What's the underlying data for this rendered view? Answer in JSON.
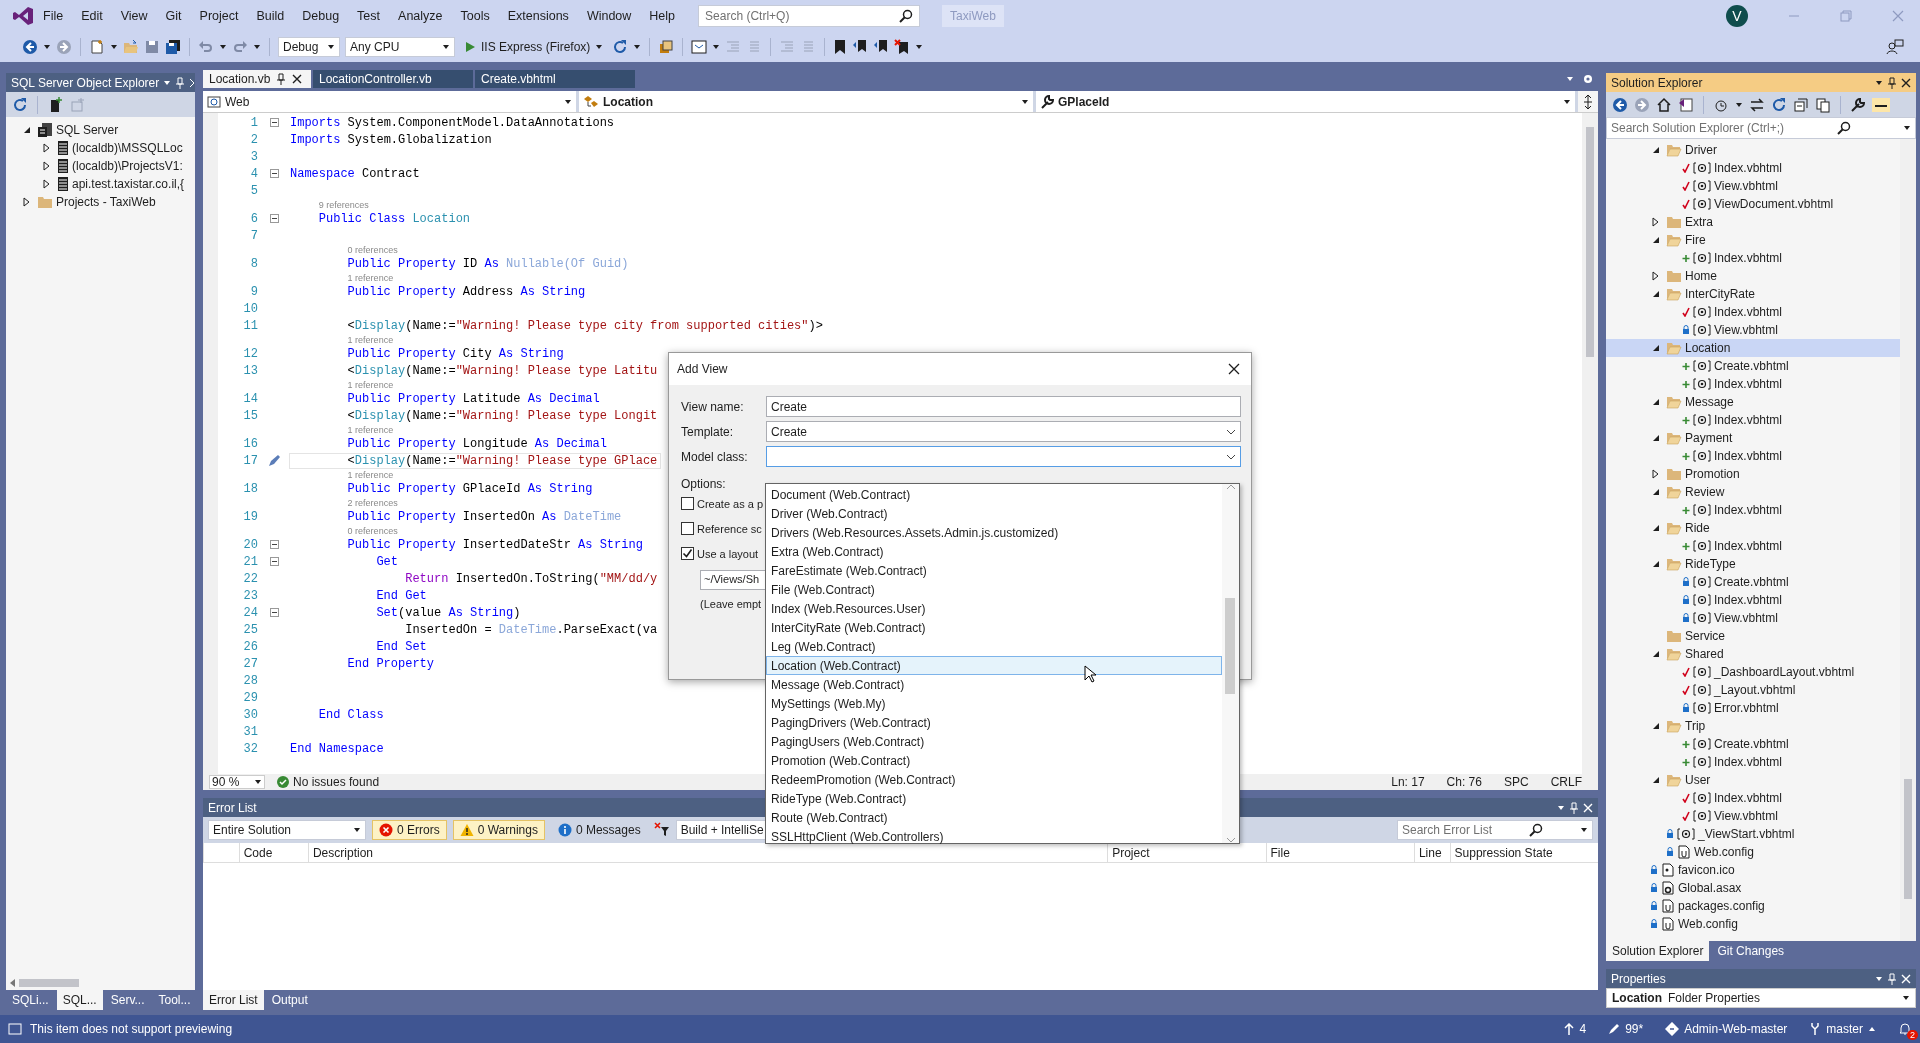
{
  "menu_bar": {
    "items": [
      "File",
      "Edit",
      "View",
      "Git",
      "Project",
      "Build",
      "Debug",
      "Test",
      "Analyze",
      "Tools",
      "Extensions",
      "Window",
      "Help"
    ],
    "search": {
      "placeholder": "Search (Ctrl+Q)"
    },
    "solution_name": "TaxiWeb",
    "avatar": "V"
  },
  "toolbar": {
    "configuration": "Debug",
    "platform": "Any CPU",
    "run_target": "IIS Express (Firefox)"
  },
  "sql_explorer": {
    "title": "SQL Server Object Explorer",
    "tree": [
      {
        "label": "SQL Server",
        "kind": "server-group",
        "expanded": true,
        "selected": false,
        "children": [
          {
            "label": "(localdb)\\MSSQLLoc",
            "kind": "server",
            "expanded": false,
            "selected": false
          },
          {
            "label": "(localdb)\\ProjectsV1:",
            "kind": "server",
            "expanded": false,
            "selected": false
          },
          {
            "label": "api.test.taxistar.co.il,{",
            "kind": "server",
            "expanded": false,
            "selected": false
          }
        ]
      },
      {
        "label": "Projects - TaxiWeb",
        "kind": "folder",
        "expanded": false,
        "selected": false
      }
    ],
    "tabs": [
      {
        "label": "SQLi...",
        "selected": false
      },
      {
        "label": "SQL...",
        "selected": true
      },
      {
        "label": "Serv...",
        "selected": false
      },
      {
        "label": "Tool...",
        "selected": false
      }
    ]
  },
  "editor": {
    "tabs": [
      {
        "label": "Location.vb",
        "selected": true
      },
      {
        "label": "LocationController.vb",
        "selected": false
      },
      {
        "label": "Create.vbhtml",
        "selected": false
      }
    ],
    "nav": {
      "project": "Web",
      "type": "Location",
      "member": "GPlaceId"
    },
    "lines": [
      {
        "kind": "code",
        "number": "1",
        "fold": true,
        "tokens": [
          {
            "kind": "keyword",
            "text": "Imports"
          },
          {
            "kind": "text",
            "text": " System.ComponentModel.DataAnnotations"
          }
        ]
      },
      {
        "kind": "code",
        "number": "2",
        "tokens": [
          {
            "kind": "keyword",
            "text": "Imports"
          },
          {
            "kind": "text",
            "text": " System.Globalization"
          }
        ]
      },
      {
        "kind": "code",
        "number": "3"
      },
      {
        "kind": "code",
        "number": "4",
        "fold": true,
        "tokens": [
          {
            "kind": "keyword",
            "text": "Namespace"
          },
          {
            "kind": "text",
            "text": " Contract"
          }
        ]
      },
      {
        "kind": "code",
        "number": "5"
      },
      {
        "kind": "lens",
        "text": "9 references"
      },
      {
        "kind": "code",
        "number": "6",
        "fold": true,
        "tokens": [
          {
            "kind": "keyword",
            "text": "    Public Class"
          },
          {
            "kind": "type",
            "text": " Location"
          }
        ]
      },
      {
        "kind": "code",
        "number": "7"
      },
      {
        "kind": "lens",
        "text": "0 references"
      },
      {
        "kind": "code",
        "number": "8",
        "tokens": [
          {
            "kind": "keyword",
            "text": "        Public Property"
          },
          {
            "kind": "text",
            "text": " ID "
          },
          {
            "kind": "keyword",
            "text": "As"
          },
          {
            "kind": "faded",
            "text": " Nullable(Of Guid)"
          }
        ]
      },
      {
        "kind": "lens",
        "text": "1 reference"
      },
      {
        "kind": "code",
        "number": "9",
        "tokens": [
          {
            "kind": "keyword",
            "text": "        Public Property"
          },
          {
            "kind": "text",
            "text": " Address "
          },
          {
            "kind": "keyword",
            "text": "As String"
          }
        ]
      },
      {
        "kind": "code",
        "number": "10"
      },
      {
        "kind": "code",
        "number": "11",
        "tokens": [
          {
            "kind": "text",
            "text": "        <"
          },
          {
            "kind": "type",
            "text": "Display"
          },
          {
            "kind": "text",
            "text": "(Name:="
          },
          {
            "kind": "string",
            "text": "\"Warning! Please type city from supported cities\""
          },
          {
            "kind": "text",
            "text": ")>"
          }
        ]
      },
      {
        "kind": "lens",
        "text": "1 reference"
      },
      {
        "kind": "code",
        "number": "12",
        "tokens": [
          {
            "kind": "keyword",
            "text": "        Public Property"
          },
          {
            "kind": "text",
            "text": " City "
          },
          {
            "kind": "keyword",
            "text": "As String"
          }
        ]
      },
      {
        "kind": "code",
        "number": "13",
        "tokens": [
          {
            "kind": "text",
            "text": "        <"
          },
          {
            "kind": "type",
            "text": "Display"
          },
          {
            "kind": "text",
            "text": "(Name:="
          },
          {
            "kind": "string",
            "text": "\"Warning! Please type Latitu"
          }
        ]
      },
      {
        "kind": "lens",
        "text": "1 reference"
      },
      {
        "kind": "code",
        "number": "14",
        "tokens": [
          {
            "kind": "keyword",
            "text": "        Public Property"
          },
          {
            "kind": "text",
            "text": " Latitude "
          },
          {
            "kind": "keyword",
            "text": "As Decimal"
          }
        ]
      },
      {
        "kind": "code",
        "number": "15",
        "tokens": [
          {
            "kind": "text",
            "text": "        <"
          },
          {
            "kind": "type",
            "text": "Display"
          },
          {
            "kind": "text",
            "text": "(Name:="
          },
          {
            "kind": "string",
            "text": "\"Warning! Please type Longit"
          }
        ]
      },
      {
        "kind": "lens",
        "text": "1 reference"
      },
      {
        "kind": "code",
        "number": "16",
        "tokens": [
          {
            "kind": "keyword",
            "text": "        Public Property"
          },
          {
            "kind": "text",
            "text": " Longitude "
          },
          {
            "kind": "keyword",
            "text": "As Decimal"
          }
        ]
      },
      {
        "kind": "code",
        "number": "17",
        "current": true,
        "tokens": [
          {
            "kind": "text",
            "text": "        <"
          },
          {
            "kind": "type",
            "text": "Display"
          },
          {
            "kind": "text",
            "text": "(Name:="
          },
          {
            "kind": "string",
            "text": "\"Warning! Please type GPlace"
          }
        ]
      },
      {
        "kind": "lens",
        "text": "1 reference"
      },
      {
        "kind": "code",
        "number": "18",
        "tokens": [
          {
            "kind": "keyword",
            "text": "        Public Property"
          },
          {
            "kind": "text",
            "text": " GPlaceId "
          },
          {
            "kind": "keyword",
            "text": "As String"
          }
        ]
      },
      {
        "kind": "lens",
        "text": "2 references"
      },
      {
        "kind": "code",
        "number": "19",
        "tokens": [
          {
            "kind": "keyword",
            "text": "        Public Property"
          },
          {
            "kind": "text",
            "text": " InsertedOn "
          },
          {
            "kind": "keyword",
            "text": "As"
          },
          {
            "kind": "faded",
            "text": " DateTime"
          }
        ]
      },
      {
        "kind": "lens",
        "text": "0 references"
      },
      {
        "kind": "code",
        "number": "20",
        "fold": true,
        "tokens": [
          {
            "kind": "keyword",
            "text": "        Public Property"
          },
          {
            "kind": "text",
            "text": " InsertedDateStr "
          },
          {
            "kind": "keyword",
            "text": "As String"
          }
        ]
      },
      {
        "kind": "code",
        "number": "21",
        "fold": true,
        "tokens": [
          {
            "kind": "keyword",
            "text": "            Get"
          }
        ]
      },
      {
        "kind": "code",
        "number": "22",
        "tokens": [
          {
            "kind": "control",
            "text": "                Return"
          },
          {
            "kind": "text",
            "text": " InsertedOn.ToString("
          },
          {
            "kind": "string",
            "text": "\"MM/dd/y"
          }
        ]
      },
      {
        "kind": "code",
        "number": "23",
        "tokens": [
          {
            "kind": "keyword",
            "text": "            End Get"
          }
        ]
      },
      {
        "kind": "code",
        "number": "24",
        "fold": true,
        "tokens": [
          {
            "kind": "keyword",
            "text": "            Set"
          },
          {
            "kind": "text",
            "text": "(value "
          },
          {
            "kind": "keyword",
            "text": "As String"
          },
          {
            "kind": "text",
            "text": ")"
          }
        ]
      },
      {
        "kind": "code",
        "number": "25",
        "tokens": [
          {
            "kind": "text",
            "text": "                InsertedOn = "
          },
          {
            "kind": "faded",
            "text": "DateTime"
          },
          {
            "kind": "text",
            "text": ".ParseExact(va"
          }
        ]
      },
      {
        "kind": "code",
        "number": "26",
        "tokens": [
          {
            "kind": "keyword",
            "text": "            End Set"
          }
        ]
      },
      {
        "kind": "code",
        "number": "27",
        "tokens": [
          {
            "kind": "keyword",
            "text": "        End Property"
          }
        ]
      },
      {
        "kind": "code",
        "number": "28"
      },
      {
        "kind": "code",
        "number": "29"
      },
      {
        "kind": "code",
        "number": "30",
        "tokens": [
          {
            "kind": "keyword",
            "text": "    End Class"
          }
        ]
      },
      {
        "kind": "code",
        "number": "31"
      },
      {
        "kind": "code",
        "number": "32",
        "tokens": [
          {
            "kind": "keyword",
            "text": "End Namespace"
          }
        ]
      }
    ],
    "status": {
      "zoom": "90 %",
      "issues": "No issues found",
      "line": "Ln: 17",
      "column": "Ch: 76",
      "whitespace": "SPC",
      "line_ending": "CRLF"
    }
  },
  "error_list": {
    "title": "Error List",
    "scope": "Entire Solution",
    "filters": [
      {
        "label": "0 Errors",
        "kind": "error",
        "on": true
      },
      {
        "label": "0 Warnings",
        "kind": "warning",
        "on": true
      },
      {
        "label": "0 Messages",
        "kind": "message",
        "on": false
      }
    ],
    "source": "Build + IntelliSe",
    "search": {
      "placeholder": "Search Error List"
    },
    "columns": [
      "Code",
      "Description",
      "Project",
      "File",
      "Line",
      "Suppression State"
    ],
    "tabs": [
      {
        "label": "Error List",
        "selected": true
      },
      {
        "label": "Output",
        "selected": false
      }
    ]
  },
  "solution_explorer": {
    "title": "Solution Explorer",
    "search": {
      "placeholder": "Search Solution Explorer (Ctrl+;)"
    },
    "view_folders": [
      {
        "label": "Driver",
        "kind": "folder",
        "expanded": true,
        "selected": false,
        "children": [
          {
            "label": "Index.vbhtml",
            "kind": "razor",
            "modified": true,
            "selected": false
          },
          {
            "label": "View.vbhtml",
            "kind": "razor",
            "modified": true,
            "selected": false
          },
          {
            "label": "ViewDocument.vbhtml",
            "kind": "razor",
            "modified": true,
            "selected": false
          }
        ]
      },
      {
        "label": "Extra",
        "kind": "folder",
        "expanded": false,
        "selected": false
      },
      {
        "label": "Fire",
        "kind": "folder",
        "expanded": true,
        "selected": false,
        "children": [
          {
            "label": "Index.vbhtml",
            "kind": "razor",
            "modified": false,
            "added": true,
            "selected": false
          }
        ]
      },
      {
        "label": "Home",
        "kind": "folder",
        "expanded": false,
        "selected": false
      },
      {
        "label": "InterCityRate",
        "kind": "folder",
        "expanded": true,
        "selected": false,
        "children": [
          {
            "label": "Index.vbhtml",
            "kind": "razor",
            "modified": true,
            "selected": false
          },
          {
            "label": "View.vbhtml",
            "kind": "razor",
            "modified": false,
            "added": false,
            "selected": false
          }
        ]
      },
      {
        "label": "Location",
        "kind": "folder",
        "expanded": true,
        "selected": true,
        "children": [
          {
            "label": "Create.vbhtml",
            "kind": "razor",
            "modified": false,
            "added": true,
            "selected": false
          },
          {
            "label": "Index.vbhtml",
            "kind": "razor",
            "modified": false,
            "added": true,
            "selected": false
          }
        ]
      },
      {
        "label": "Message",
        "kind": "folder",
        "expanded": true,
        "selected": false,
        "children": [
          {
            "label": "Index.vbhtml",
            "kind": "razor",
            "modified": false,
            "added": true,
            "selected": false
          }
        ]
      },
      {
        "label": "Payment",
        "kind": "folder",
        "expanded": true,
        "selected": false,
        "children": [
          {
            "label": "Index.vbhtml",
            "kind": "razor",
            "modified": false,
            "added": true,
            "selected": false
          }
        ]
      },
      {
        "label": "Promotion",
        "kind": "folder",
        "expanded": false,
        "selected": false
      },
      {
        "label": "Review",
        "kind": "folder",
        "expanded": true,
        "selected": false,
        "children": [
          {
            "label": "Index.vbhtml",
            "kind": "razor",
            "modified": false,
            "added": true,
            "selected": false
          }
        ]
      },
      {
        "label": "Ride",
        "kind": "folder",
        "expanded": true,
        "selected": false,
        "children": [
          {
            "label": "Index.vbhtml",
            "kind": "razor",
            "modified": false,
            "added": true,
            "selected": false
          }
        ]
      },
      {
        "label": "RideType",
        "kind": "folder",
        "expanded": true,
        "selected": false,
        "children": [
          {
            "label": "Create.vbhtml",
            "kind": "razor",
            "modified": false,
            "added": false,
            "selected": false
          },
          {
            "label": "Index.vbhtml",
            "kind": "razor",
            "modified": false,
            "added": false,
            "selected": false
          },
          {
            "label": "View.vbhtml",
            "kind": "razor",
            "modified": false,
            "added": false,
            "selected": false
          }
        ]
      },
      {
        "label": "Service",
        "kind": "folder",
        "selected": false
      },
      {
        "label": "Shared",
        "kind": "folder",
        "expanded": true,
        "selected": false,
        "children": [
          {
            "label": "_DashboardLayout.vbhtml",
            "kind": "razor",
            "modified": true,
            "selected": false
          },
          {
            "label": "_Layout.vbhtml",
            "kind": "razor",
            "modified": true,
            "selected": false
          },
          {
            "label": "Error.vbhtml",
            "kind": "razor",
            "modified": false,
            "added": false,
            "selected": false
          }
        ]
      },
      {
        "label": "Trip",
        "kind": "folder",
        "expanded": true,
        "selected": false,
        "children": [
          {
            "label": "Create.vbhtml",
            "kind": "razor",
            "modified": false,
            "added": true,
            "selected": false
          },
          {
            "label": "Index.vbhtml",
            "kind": "razor",
            "modified": false,
            "added": true,
            "selected": false
          }
        ]
      },
      {
        "label": "User",
        "kind": "folder",
        "expanded": true,
        "selected": false,
        "children": [
          {
            "label": "Index.vbhtml",
            "kind": "razor",
            "modified": true,
            "selected": false
          },
          {
            "label": "View.vbhtml",
            "kind": "razor",
            "modified": true,
            "selected": false
          }
        ]
      },
      {
        "label": "_ViewStart.vbhtml",
        "kind": "razor",
        "modified": false,
        "added": false,
        "selected": false
      },
      {
        "label": "Web.config",
        "kind": "config",
        "modified": false,
        "added": false,
        "selected": false
      }
    ],
    "root_items": [
      {
        "label": "favicon.ico",
        "kind": "image",
        "modified": false,
        "added": false,
        "selected": false
      },
      {
        "label": "Global.asax",
        "kind": "asax",
        "modified": false,
        "added": false,
        "selected": false
      },
      {
        "label": "packages.config",
        "kind": "config",
        "modified": false,
        "added": false,
        "selected": false
      },
      {
        "label": "Web.config",
        "kind": "config",
        "modified": false,
        "added": false,
        "selected": false
      }
    ],
    "tabs": [
      {
        "label": "Solution Explorer",
        "selected": true
      },
      {
        "label": "Git Changes",
        "selected": false
      }
    ]
  },
  "properties": {
    "title": "Properties",
    "object": "Location",
    "object_type": "Folder Properties"
  },
  "status_bar": {
    "message": "This item does not support previewing",
    "unpushed": "4",
    "changes": "99*",
    "repository": "Admin-Web-master",
    "branch": "master",
    "notifications": "2"
  },
  "add_view_dialog": {
    "title": "Add View",
    "fields": [
      {
        "label": "View name:",
        "kind": "text",
        "value": "Create"
      },
      {
        "label": "Template:",
        "kind": "dropdown",
        "value": "Create"
      },
      {
        "label": "Model class:",
        "kind": "dropdown",
        "expanded": true
      }
    ],
    "options_label": "Options:",
    "options": [
      {
        "label": "Create as a p",
        "checked": false
      },
      {
        "label": "Reference sc",
        "checked": false
      },
      {
        "label": "Use a layout",
        "checked": true
      }
    ],
    "layout_path": "~/Views/Sh",
    "layout_hint": "(Leave empt",
    "model_list": [
      {
        "label": "Document (Web.Contract)",
        "selected": false
      },
      {
        "label": "Driver (Web.Contract)",
        "selected": false
      },
      {
        "label": "Drivers (Web.Resources.Assets.Admin.js.customized)",
        "selected": false
      },
      {
        "label": "Extra (Web.Contract)",
        "selected": false
      },
      {
        "label": "FareEstimate (Web.Contract)",
        "selected": false
      },
      {
        "label": "File (Web.Contract)",
        "selected": false
      },
      {
        "label": "Index (Web.Resources.User)",
        "selected": false
      },
      {
        "label": "InterCityRate (Web.Contract)",
        "selected": false
      },
      {
        "label": "Leg (Web.Contract)",
        "selected": false
      },
      {
        "label": "Location (Web.Contract)",
        "selected": true
      },
      {
        "label": "Message (Web.Contract)",
        "selected": false
      },
      {
        "label": "MySettings (Web.My)",
        "selected": false
      },
      {
        "label": "PagingDrivers (Web.Contract)",
        "selected": false
      },
      {
        "label": "PagingUsers (Web.Contract)",
        "selected": false
      },
      {
        "label": "Promotion (Web.Contract)",
        "selected": false
      },
      {
        "label": "RedeemPromotion (Web.Contract)",
        "selected": false
      },
      {
        "label": "RideType (Web.Contract)",
        "selected": false
      },
      {
        "label": "Route (Web.Contract)",
        "selected": false
      },
      {
        "label": "SSLHttpClient (Web.Controllers)",
        "selected": false
      }
    ]
  }
}
